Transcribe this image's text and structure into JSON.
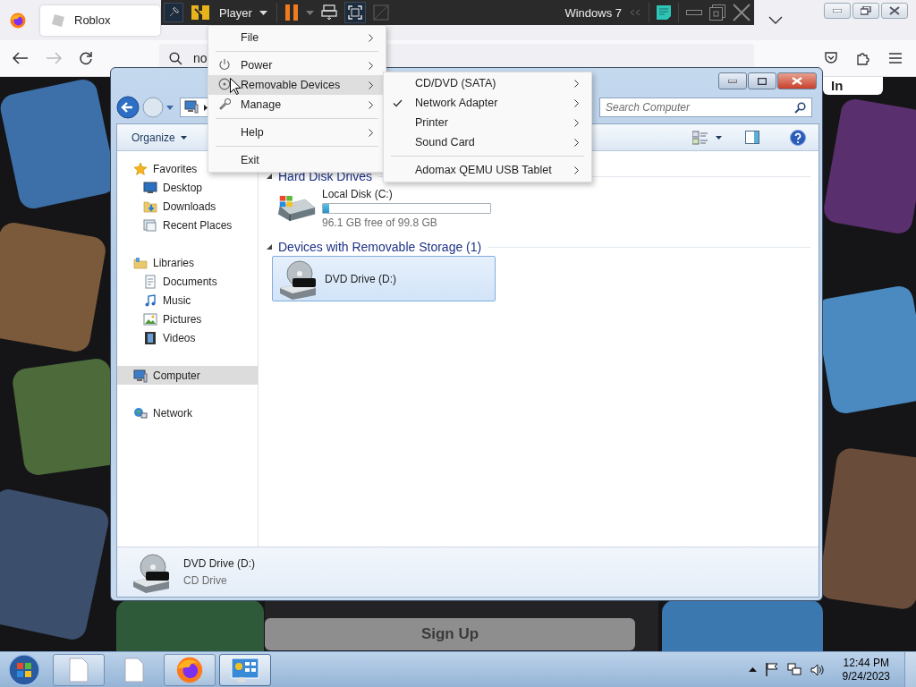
{
  "browser": {
    "tab_title": "Roblox",
    "address_text": "no",
    "login_button": "In",
    "signup_button": "Sign Up"
  },
  "vm_toolbar": {
    "menu_label": "Player",
    "vm_name": "Windows 7"
  },
  "player_menu": {
    "items": [
      {
        "label": "File",
        "selected": false,
        "separator_after": true
      },
      {
        "label": "Power",
        "selected": false,
        "separator_after": false
      },
      {
        "label": "Removable Devices",
        "selected": true,
        "separator_after": false
      },
      {
        "label": "Manage",
        "selected": false,
        "separator_after": true
      },
      {
        "label": "Help",
        "selected": false,
        "separator_after": true
      },
      {
        "label": "Exit",
        "selected": false,
        "separator_after": false
      }
    ]
  },
  "submenu": {
    "items": [
      {
        "label": "CD/DVD (SATA)",
        "checked": false,
        "separator_after": false
      },
      {
        "label": "Network Adapter",
        "checked": true,
        "separator_after": false
      },
      {
        "label": "Printer",
        "checked": false,
        "separator_after": false
      },
      {
        "label": "Sound Card",
        "checked": false,
        "separator_after": true
      },
      {
        "label": "Adomax QEMU USB Tablet",
        "checked": false,
        "separator_after": false
      }
    ]
  },
  "explorer": {
    "search_placeholder": "Search Computer",
    "organize": "Organize",
    "nav": [
      {
        "label": "Favorites",
        "selected": false,
        "children": [
          {
            "label": "Desktop",
            "selected": false
          },
          {
            "label": "Downloads",
            "selected": false
          },
          {
            "label": "Recent Places",
            "selected": false
          }
        ]
      },
      {
        "label": "Libraries",
        "selected": false,
        "children": [
          {
            "label": "Documents",
            "selected": false
          },
          {
            "label": "Music",
            "selected": false
          },
          {
            "label": "Pictures",
            "selected": false
          },
          {
            "label": "Videos",
            "selected": false
          }
        ]
      },
      {
        "label": "Computer",
        "selected": true
      },
      {
        "label": "Network",
        "selected": false
      }
    ],
    "sections": [
      {
        "title": "Hard Disk Drives",
        "items": [
          {
            "kind": "disk",
            "name": "Local Disk (C:)",
            "level": 0.037,
            "free_text": "96.1 GB free of 99.8 GB",
            "selected": false
          }
        ]
      },
      {
        "title": "Devices with Removable Storage (1)",
        "items": [
          {
            "kind": "dvd",
            "name": "DVD Drive (D:)",
            "selected": true
          }
        ]
      }
    ],
    "details": {
      "name": "DVD Drive (D:)",
      "type": "CD Drive"
    }
  },
  "taskbar": {
    "buttons": [
      {
        "running": true,
        "selected": false
      },
      {
        "running": false,
        "selected": false
      },
      {
        "running": true,
        "selected": false
      },
      {
        "running": true,
        "selected": true
      }
    ],
    "time": "12:44 PM",
    "date": "9/24/2023"
  }
}
